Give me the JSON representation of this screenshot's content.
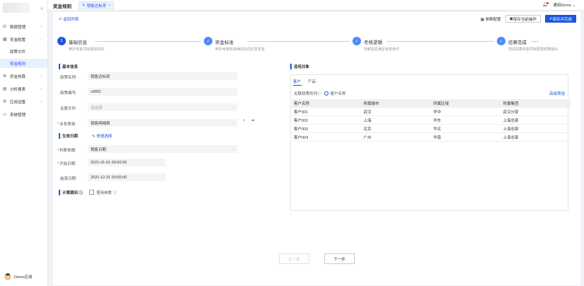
{
  "sidebar": {
    "items": [
      {
        "label": "数据管理",
        "icon": "database-icon",
        "expanded": false
      },
      {
        "label": "奖金配置",
        "icon": "grid-icon",
        "expanded": true
      },
      {
        "label": "奖金核算",
        "icon": "cog-icon",
        "expanded": false
      },
      {
        "label": "分析报表",
        "icon": "chart-icon",
        "expanded": false
      },
      {
        "label": "应用设置",
        "icon": "settings-icon",
        "expanded": false
      },
      {
        "label": "系统管理",
        "icon": "monitor-icon",
        "expanded": false
      }
    ],
    "subitems": [
      {
        "label": "政策文件",
        "active": false
      },
      {
        "label": "奖金规则",
        "active": true
      }
    ],
    "user_name": "Demo应用"
  },
  "topbar": {
    "title": "奖金规则",
    "tab_label": "销售达标奖",
    "user_label": "通用Demo"
  },
  "toolbar": {
    "back_label": "返回列表",
    "param_config": "参数配置",
    "save_action": "保存当前操作",
    "save_finish": "保存并完成"
  },
  "steps": [
    {
      "number": "1",
      "title": "基础信息",
      "desc": "维护奖金项目基础信息"
    },
    {
      "title": "奖金标准",
      "desc": "维护考核标准满足后的应发奖金"
    },
    {
      "title": "考核逻辑",
      "desc": "判断是否满足考核条件"
    },
    {
      "title": "验算完成",
      "desc": "测试验算奖金项目配置结果输出"
    }
  ],
  "form": {
    "section_basic": "基本信息",
    "policy_name_label": "政策名称:",
    "policy_name_value": "销售达标奖",
    "policy_code_label": "政策编号:",
    "policy_code_value": "s0001",
    "related_file_label": "关联文件:",
    "related_file_placeholder": "请选择",
    "biz_table_label": "业务表单:",
    "biz_table_value": "销售明细表",
    "section_date": "生效日期",
    "quick_select": "快速选择",
    "judge_basis_label": "判断依据:",
    "judge_basis_value": "销售日期",
    "start_date_label": "开始日期:",
    "start_date_value": "2021-01-01 00:00:00",
    "end_date_label": "结束日期:",
    "end_date_value": "2021-12-31 00:00:00",
    "calc_period_label": "计算期间",
    "use_param_label": "使用参数"
  },
  "scope": {
    "title": "适用对象",
    "tabs": [
      "客户",
      "产品"
    ],
    "filter_label": "关联政策的列",
    "radio_label": "客户名称",
    "advanced_filter": "高级筛选",
    "columns": [
      "客户名称",
      "所属城市",
      "所属区域",
      "所属集团"
    ],
    "rows": [
      [
        "客户001",
        "武汉",
        "华中",
        "武汉分部"
      ],
      [
        "客户002",
        "上海",
        "华东",
        "上海总部"
      ],
      [
        "客户003",
        "北京",
        "华北",
        "上海总部"
      ],
      [
        "客户004",
        "广州",
        "华南",
        "上海总部"
      ]
    ]
  },
  "footer": {
    "prev": "上一步",
    "next": "下一步"
  }
}
